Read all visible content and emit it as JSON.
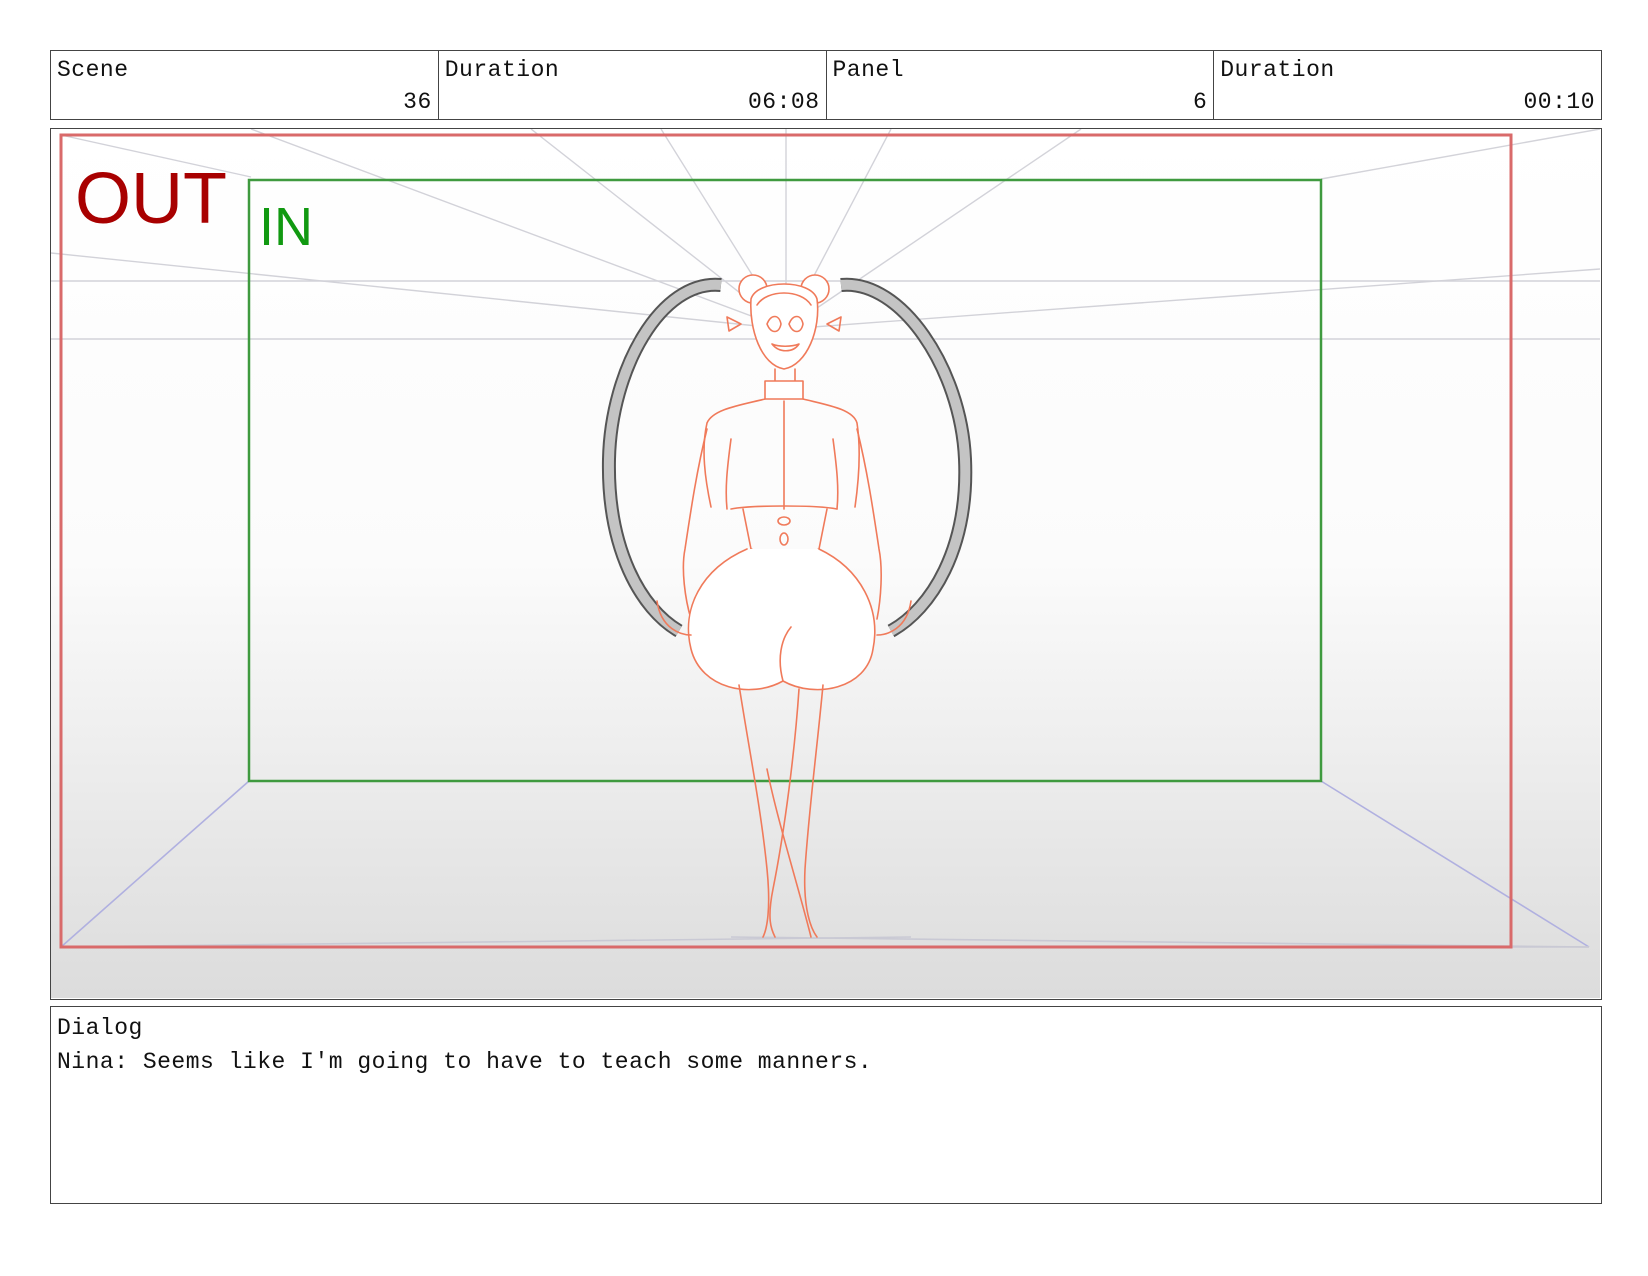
{
  "header": {
    "scene_label": "Scene",
    "scene_value": "36",
    "scene_duration_label": "Duration",
    "scene_duration_value": "06:08",
    "panel_label": "Panel",
    "panel_value": "6",
    "panel_duration_label": "Duration",
    "panel_duration_value": "00:10"
  },
  "panel": {
    "out_label": "OUT",
    "in_label": "IN",
    "colors": {
      "out_frame": "#d96a6a",
      "out_text": "#a80000",
      "in_frame": "#3f9a3f",
      "in_text": "#119911",
      "sketch": "#f07a5a",
      "guides": "#c8c8d0",
      "perspective": "#b0b0e0",
      "hoop": "#9a9a9a"
    }
  },
  "dialog": {
    "label": "Dialog",
    "text": "Nina: Seems like I'm going to have to teach some manners."
  }
}
